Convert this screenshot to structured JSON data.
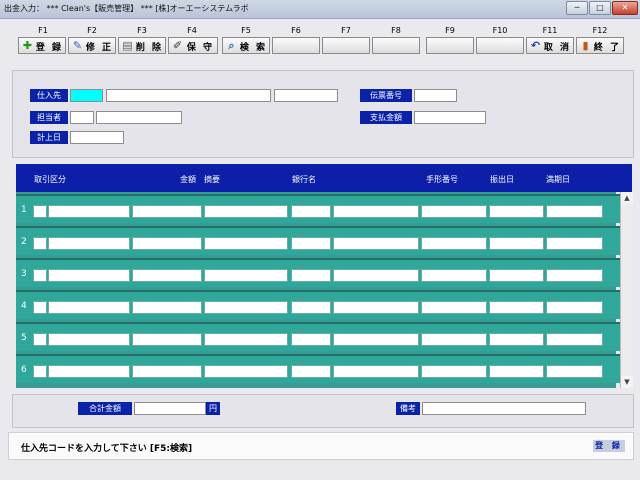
{
  "window": {
    "title": "出金入力： *** Clean's【販売管理】 *** [株]オーエーシステムラボ",
    "min_label": "─",
    "max_label": "□",
    "close_label": "✕"
  },
  "fkeys": [
    {
      "key": "F1",
      "label": "登 録",
      "icon": "plus-icon"
    },
    {
      "key": "F2",
      "label": "修 正",
      "icon": "pencil-icon"
    },
    {
      "key": "F3",
      "label": "削 除",
      "icon": "printer-icon"
    },
    {
      "key": "F4",
      "label": "保 守",
      "icon": "edit-icon"
    },
    {
      "key": "F5",
      "label": "検 索",
      "icon": "search-icon"
    },
    {
      "key": "F6",
      "label": "",
      "icon": ""
    },
    {
      "key": "F7",
      "label": "",
      "icon": ""
    },
    {
      "key": "F8",
      "label": "",
      "icon": ""
    },
    {
      "key": "F9",
      "label": "",
      "icon": ""
    },
    {
      "key": "F10",
      "label": "",
      "icon": ""
    },
    {
      "key": "F11",
      "label": "取 消",
      "icon": "undo-icon"
    },
    {
      "key": "F12",
      "label": "終 了",
      "icon": "exit-icon"
    }
  ],
  "header_form": {
    "supplier_label": "仕入先",
    "staff_label": "担当者",
    "date_label": "計上日",
    "slip_no_label": "伝票番号",
    "payment_amount_label": "支払金額",
    "supplier_code": "",
    "supplier_name": ""
  },
  "grid": {
    "columns": [
      "取引区分",
      "金額",
      "摘要",
      "銀行名",
      "手形番号",
      "振出日",
      "満期日"
    ],
    "row_numbers": [
      "1",
      "2",
      "3",
      "4",
      "5",
      "6"
    ]
  },
  "footer_form": {
    "total_label": "合計金額",
    "yen_label": "円",
    "remarks_label": "備考"
  },
  "status": {
    "message": "仕入先コードを入力して下さい [F5:検索]",
    "mode": "登 録"
  },
  "colors": {
    "label_bg": "#0a22a8",
    "grid_bg": "#2fa79a",
    "focus_input": "#00ffff"
  }
}
